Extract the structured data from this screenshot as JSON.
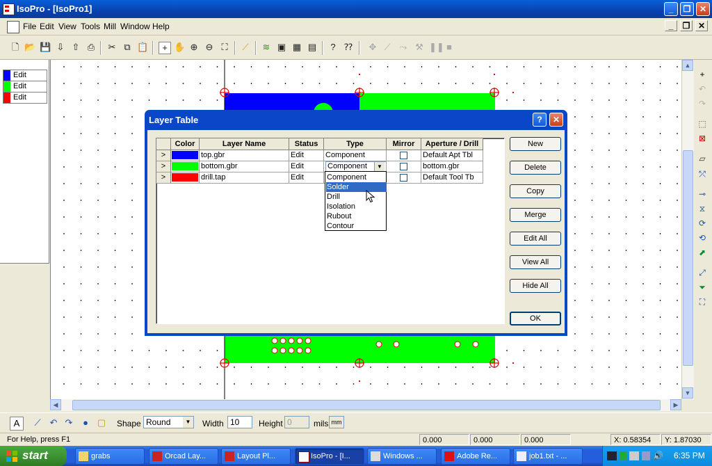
{
  "window": {
    "title": "IsoPro - [IsoPro1]"
  },
  "menu": [
    "File",
    "Edit",
    "View",
    "Tools",
    "Mill",
    "Window",
    "Help"
  ],
  "layer_panel": [
    {
      "label": "Edit",
      "color": "#0000ff"
    },
    {
      "label": "Edit",
      "color": "#00ff00"
    },
    {
      "label": "Edit",
      "color": "#ff0000"
    }
  ],
  "dialog": {
    "title": "Layer Table",
    "help_label": "?",
    "close_label": "✕",
    "columns": [
      "Color",
      "Layer Name",
      "Status",
      "Type",
      "Mirror",
      "Aperture / Drill"
    ],
    "rows": [
      {
        "marker": ">",
        "color": "#0000ff",
        "name": "top.gbr",
        "status": "Edit",
        "type": "Component",
        "mirror": false,
        "aperture": "Default Apt Tbl"
      },
      {
        "marker": ">",
        "color": "#00ff00",
        "name": "bottom.gbr",
        "status": "Edit",
        "type": "Component",
        "mirror": false,
        "aperture": "bottom.gbr"
      },
      {
        "marker": ">",
        "color": "#ff0000",
        "name": "drill.tap",
        "status": "Edit",
        "type": "",
        "mirror": false,
        "aperture": "Default Tool Tb"
      }
    ],
    "type_options": [
      "Component",
      "Solder",
      "Drill",
      "Isolation",
      "Rubout",
      "Contour"
    ],
    "type_highlighted": "Solder",
    "buttons": {
      "new": "New",
      "delete": "Delete",
      "copy": "Copy",
      "merge": "Merge",
      "edit_all": "Edit All",
      "view_all": "View All",
      "hide_all": "Hide All",
      "ok": "OK"
    }
  },
  "bottom_toolbar": {
    "shape_label": "Shape",
    "shape_value": "Round",
    "width_label": "Width",
    "width_value": "10",
    "height_label": "Height",
    "height_value": "0",
    "units_label": "mils",
    "units_icon": "mm"
  },
  "status": {
    "help_text": "For Help, press F1",
    "v1": "0.000",
    "v2": "0.000",
    "v3": "0.000",
    "x_readout": "X: 0.58354",
    "y_readout": "Y: 1.87030"
  },
  "taskbar": {
    "start_label": "start",
    "tasks": [
      {
        "label": "grabs",
        "active": false
      },
      {
        "label": "Orcad Lay...",
        "active": false
      },
      {
        "label": "Layout Pl...",
        "active": false
      },
      {
        "label": "IsoPro - [I...",
        "active": true
      },
      {
        "label": "Windows ...",
        "active": false
      },
      {
        "label": "Adobe Re...",
        "active": false
      },
      {
        "label": "job1.txt - ...",
        "active": false
      }
    ],
    "clock": "6:35 PM"
  }
}
